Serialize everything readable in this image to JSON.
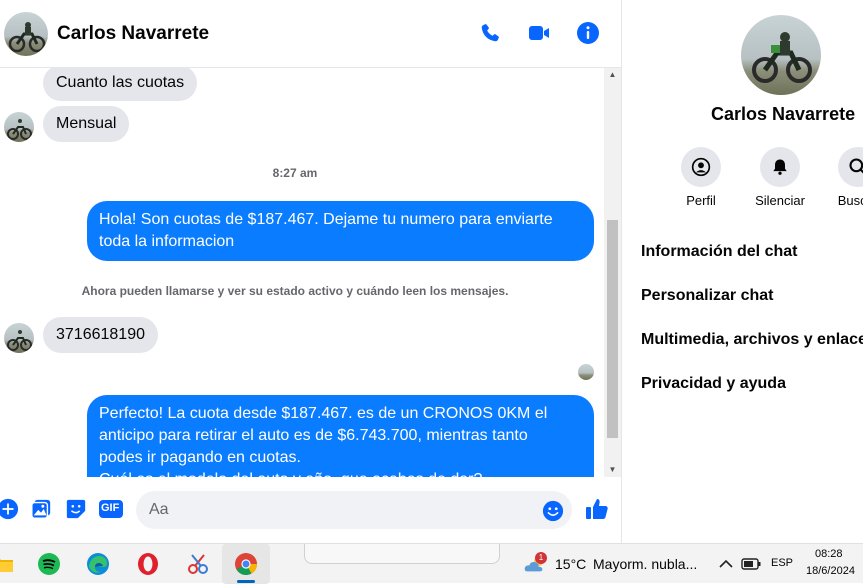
{
  "chat": {
    "contact_name": "Carlos Navarrete",
    "header_icons": [
      "phone-icon",
      "video-icon",
      "info-icon"
    ]
  },
  "messages": {
    "incoming_1": "Cuanto las cuotas",
    "incoming_2": "Mensual",
    "timestamp": "8:27 am",
    "outgoing_1_line1": "Hola! Son cuotas de $187.467. Dejame tu numero para enviarte",
    "outgoing_1_line2": "toda la informacion",
    "notice": "Ahora pueden llamarse y ver su estado activo y cuándo leen los mensajes.",
    "incoming_3": "3716618190",
    "outgoing_2_line1": "Perfecto! La cuota desde $187.467. es de un CRONOS 0KM el",
    "outgoing_2_line2": "anticipo para retirar el auto es de $6.743.700, mientras tanto",
    "outgoing_2_line3": "podes ir pagando en cuotas.",
    "outgoing_2_line4": "Cuál es el modelo del auto y año, que acabes de dar?"
  },
  "composer": {
    "placeholder": "Aa",
    "icons": [
      "plus-icon",
      "image-icon",
      "sticker-icon",
      "gif-icon",
      "emoji-icon",
      "like-icon"
    ],
    "gif_label": "GIF"
  },
  "right_panel": {
    "name": "Carlos Navarrete",
    "actions": [
      {
        "label": "Perfil",
        "icon": "profile-icon"
      },
      {
        "label": "Silenciar",
        "icon": "bell-icon"
      },
      {
        "label": "Buscar",
        "icon": "search-icon"
      }
    ],
    "menu": [
      "Información del chat",
      "Personalizar chat",
      "Multimedia, archivos y enlaces",
      "Privacidad y ayuda"
    ]
  },
  "taskbar": {
    "weather_temp": "15°C",
    "weather_desc": "Mayorm. nubla...",
    "weather_badge": "1",
    "language": "ESP",
    "time": "08:28",
    "date": "18/6/2024"
  },
  "colors": {
    "accent": "#0a7cff",
    "incoming_bubble": "#e4e6eb",
    "icon_blue": "#0866ff"
  }
}
